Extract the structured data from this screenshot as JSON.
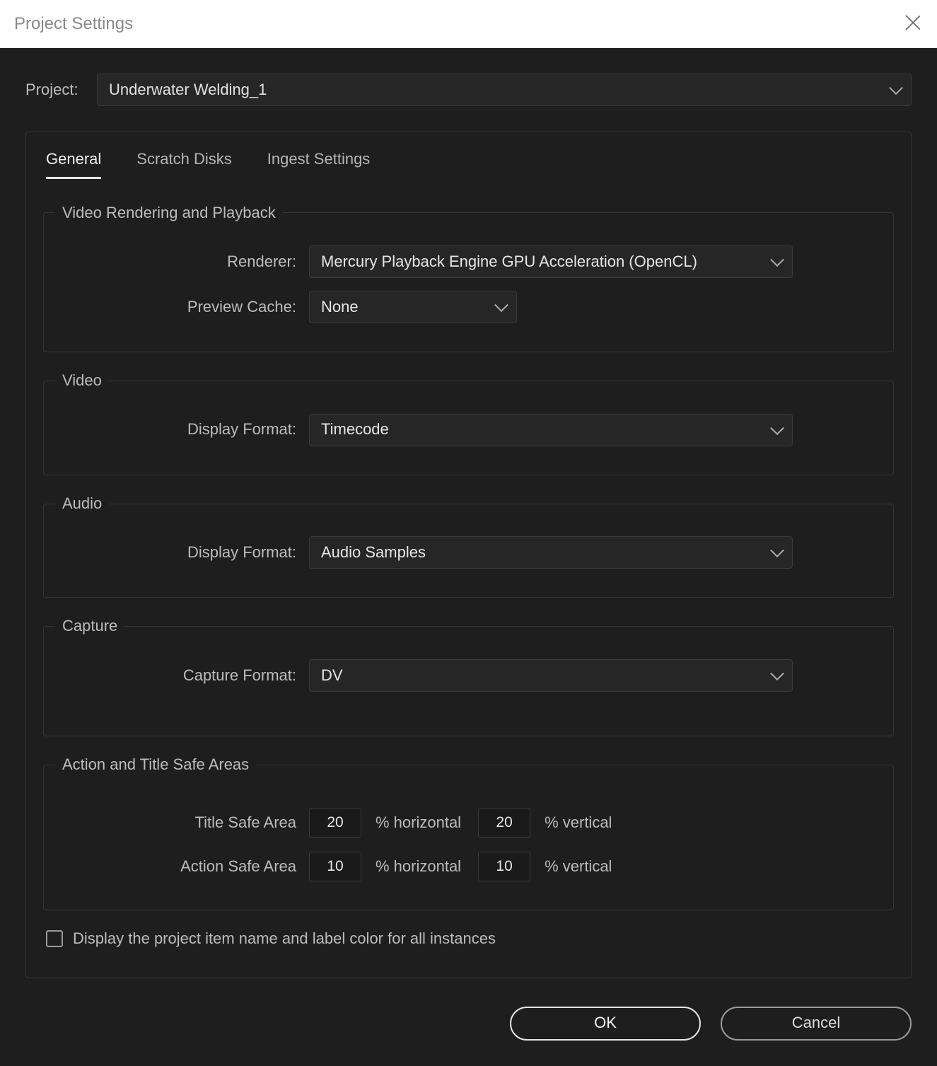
{
  "dialog": {
    "title": "Project Settings"
  },
  "project": {
    "label": "Project:",
    "name": "Underwater Welding_1"
  },
  "tabs": {
    "general": "General",
    "scratch": "Scratch Disks",
    "ingest": "Ingest Settings"
  },
  "groups": {
    "rendering": {
      "legend": "Video Rendering and Playback",
      "renderer_label": "Renderer:",
      "renderer_value": "Mercury Playback Engine GPU Acceleration (OpenCL)",
      "preview_label": "Preview Cache:",
      "preview_value": "None"
    },
    "video": {
      "legend": "Video",
      "format_label": "Display Format:",
      "format_value": "Timecode"
    },
    "audio": {
      "legend": "Audio",
      "format_label": "Display Format:",
      "format_value": "Audio Samples"
    },
    "capture": {
      "legend": "Capture",
      "format_label": "Capture Format:",
      "format_value": "DV"
    },
    "safe": {
      "legend": "Action and Title Safe Areas",
      "title_label": "Title Safe Area",
      "action_label": "Action Safe Area",
      "title_h": "20",
      "title_v": "20",
      "action_h": "10",
      "action_v": "10",
      "pct_h": "% horizontal",
      "pct_v": "% vertical"
    }
  },
  "checkbox": {
    "label": "Display the project item name and label color for all instances",
    "checked": false
  },
  "buttons": {
    "ok": "OK",
    "cancel": "Cancel"
  }
}
